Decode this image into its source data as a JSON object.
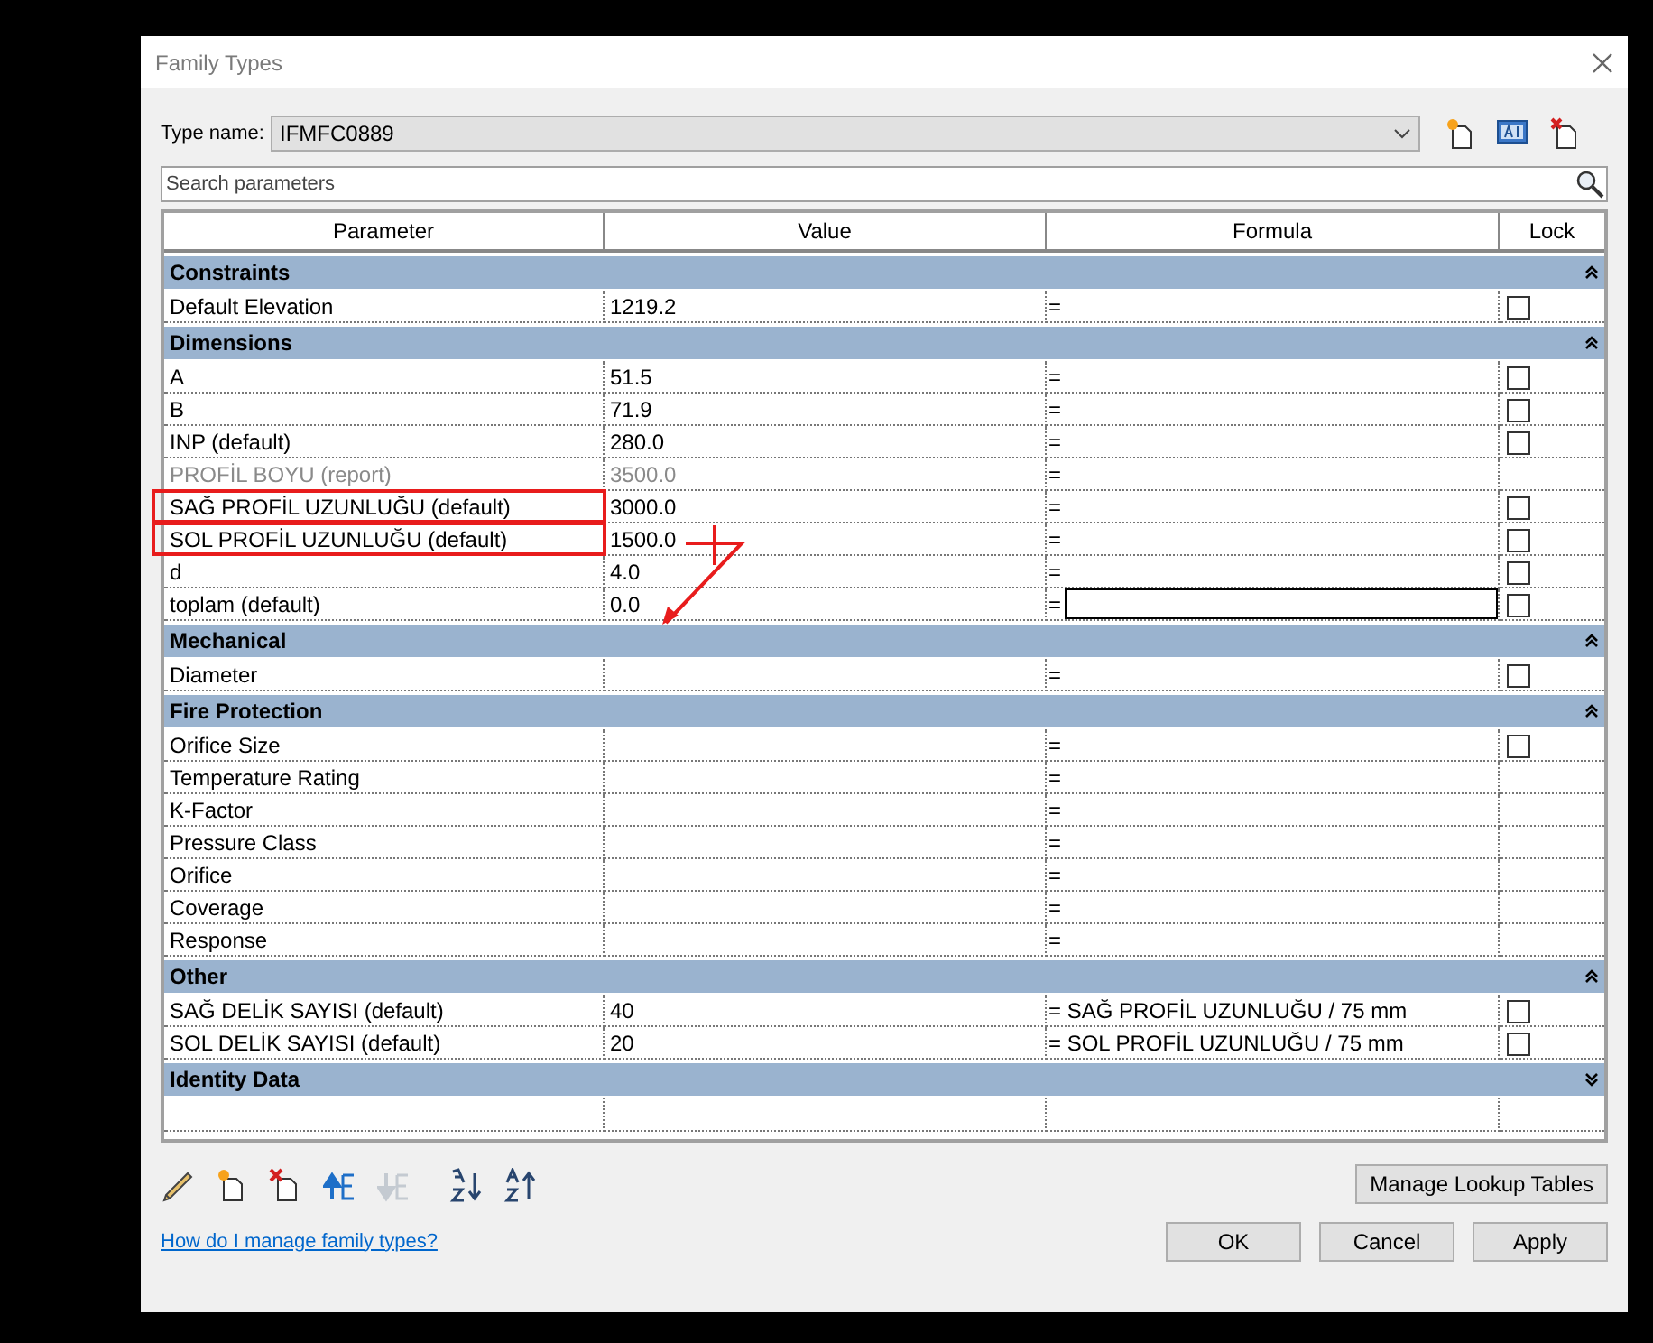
{
  "window": {
    "title": "Family Types"
  },
  "type_name": {
    "label": "Type name:",
    "value": "IFMFC0889"
  },
  "search": {
    "placeholder": "Search parameters"
  },
  "table": {
    "columns": [
      "Parameter",
      "Value",
      "Formula",
      "Lock"
    ],
    "groups": [
      {
        "name": "Constraints",
        "expanded": true,
        "rows": [
          {
            "parameter": "Default Elevation",
            "value": "1219.2",
            "formula": "=",
            "checked": false,
            "disabled": false,
            "editing": false,
            "marked": false
          }
        ]
      },
      {
        "name": "Dimensions",
        "expanded": true,
        "rows": [
          {
            "parameter": "A",
            "value": "51.5",
            "formula": "=",
            "checked": false,
            "disabled": false,
            "editing": false,
            "marked": false
          },
          {
            "parameter": "B",
            "value": "71.9",
            "formula": "=",
            "checked": false,
            "disabled": false,
            "editing": false,
            "marked": false
          },
          {
            "parameter": "INP (default)",
            "value": "280.0",
            "formula": "=",
            "checked": false,
            "disabled": false,
            "editing": false,
            "marked": false
          },
          {
            "parameter": "PROFİL BOYU (report)",
            "value": "3500.0",
            "formula": "=",
            "disabled": true,
            "editing": false,
            "marked": false
          },
          {
            "parameter": "SAĞ PROFİL UZUNLUĞU (default)",
            "value": "3000.0",
            "formula": "=",
            "checked": false,
            "disabled": false,
            "editing": false,
            "marked": true
          },
          {
            "parameter": "SOL PROFİL UZUNLUĞU (default)",
            "value": "1500.0",
            "formula": "=",
            "checked": false,
            "disabled": false,
            "editing": false,
            "marked": true
          },
          {
            "parameter": "d",
            "value": "4.0",
            "formula": "=",
            "checked": false,
            "disabled": false,
            "editing": false,
            "marked": false
          },
          {
            "parameter": "toplam (default)",
            "value": "0.0",
            "formula": "=",
            "checked": false,
            "disabled": false,
            "editing": true,
            "marked": false
          }
        ]
      },
      {
        "name": "Mechanical",
        "expanded": true,
        "rows": [
          {
            "parameter": "Diameter",
            "formula": "=",
            "checked": false,
            "disabled": false,
            "editing": false,
            "marked": false
          }
        ]
      },
      {
        "name": "Fire Protection",
        "expanded": true,
        "rows": [
          {
            "parameter": "Orifice Size",
            "formula": "=",
            "checked": false,
            "disabled": false,
            "editing": false,
            "marked": false
          },
          {
            "parameter": "Temperature Rating",
            "formula": "=",
            "disabled": false,
            "editing": false,
            "marked": false
          },
          {
            "parameter": "K-Factor",
            "formula": "=",
            "disabled": false,
            "editing": false,
            "marked": false
          },
          {
            "parameter": "Pressure Class",
            "formula": "=",
            "disabled": false,
            "editing": false,
            "marked": false
          },
          {
            "parameter": "Orifice",
            "formula": "=",
            "disabled": false,
            "editing": false,
            "marked": false
          },
          {
            "parameter": "Coverage",
            "formula": "=",
            "disabled": false,
            "editing": false,
            "marked": false
          },
          {
            "parameter": "Response",
            "formula": "=",
            "disabled": false,
            "editing": false,
            "marked": false
          }
        ]
      },
      {
        "name": "Other",
        "expanded": true,
        "rows": [
          {
            "parameter": "SAĞ DELİK SAYISI (default)",
            "value": "40",
            "formula": "= SAĞ PROFİL UZUNLUĞU / 75 mm",
            "checked": false,
            "disabled": false,
            "editing": false,
            "marked": false
          },
          {
            "parameter": "SOL DELİK SAYISI (default)",
            "value": "20",
            "formula": "= SOL PROFİL UZUNLUĞU / 75 mm",
            "checked": false,
            "disabled": false,
            "editing": false,
            "marked": false
          }
        ]
      },
      {
        "name": "Identity Data",
        "expanded": false
      }
    ]
  },
  "toolbar": [
    {
      "kind": "pencil",
      "disabled": false
    },
    {
      "kind": "new",
      "disabled": false
    },
    {
      "kind": "delete",
      "disabled": false
    },
    {
      "kind": "up",
      "disabled": false
    },
    {
      "kind": "down",
      "disabled": true
    },
    {
      "kind": "sort-asc",
      "disabled": false
    },
    {
      "kind": "sort-desc",
      "disabled": false
    }
  ],
  "lookup_button": "Manage Lookup Tables",
  "help_link": "How do I manage family types?",
  "buttons": [
    "OK",
    "Cancel",
    "Apply"
  ]
}
